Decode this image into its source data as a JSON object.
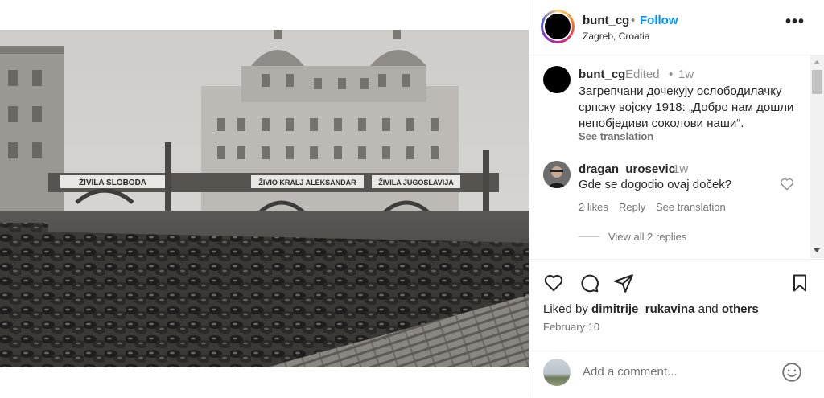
{
  "post": {
    "username": "bunt_cg",
    "separator": "•",
    "follow_label": "Follow",
    "location": "Zagreb, Croatia",
    "more_icon": "more-options-icon"
  },
  "photo": {
    "banner_left": "ŽIVILA SLOBODA",
    "banner_center": "ŽIVIO KRALJ ALEKSANDAR",
    "banner_right": "ŽIVILA JUGOSLAVIJA"
  },
  "caption": {
    "username": "bunt_cg",
    "edited": "Edited",
    "separator": "•",
    "time": "1w",
    "text": "Загрепчани дочекују ослободилачку српску војску 1918: „Добро нам дошли непобједиви соколови наши“.",
    "see_translation": "See translation"
  },
  "comment": {
    "username": "dragan_urosevic",
    "time": "1w",
    "text": "Gde se dogodio ovaj doček?",
    "likes": "2 likes",
    "reply": "Reply",
    "see_translation": "See translation"
  },
  "view_replies": "View all 2 replies",
  "actions": {
    "liked_by_prefix": "Liked by",
    "liked_by_user": "dimitrije_rukavina",
    "liked_by_and": "and",
    "liked_by_others": "others",
    "date": "February 10"
  },
  "add_comment": {
    "placeholder": "Add a comment..."
  },
  "colors": {
    "accent": "#0095f6",
    "muted": "#8e8e8e"
  }
}
